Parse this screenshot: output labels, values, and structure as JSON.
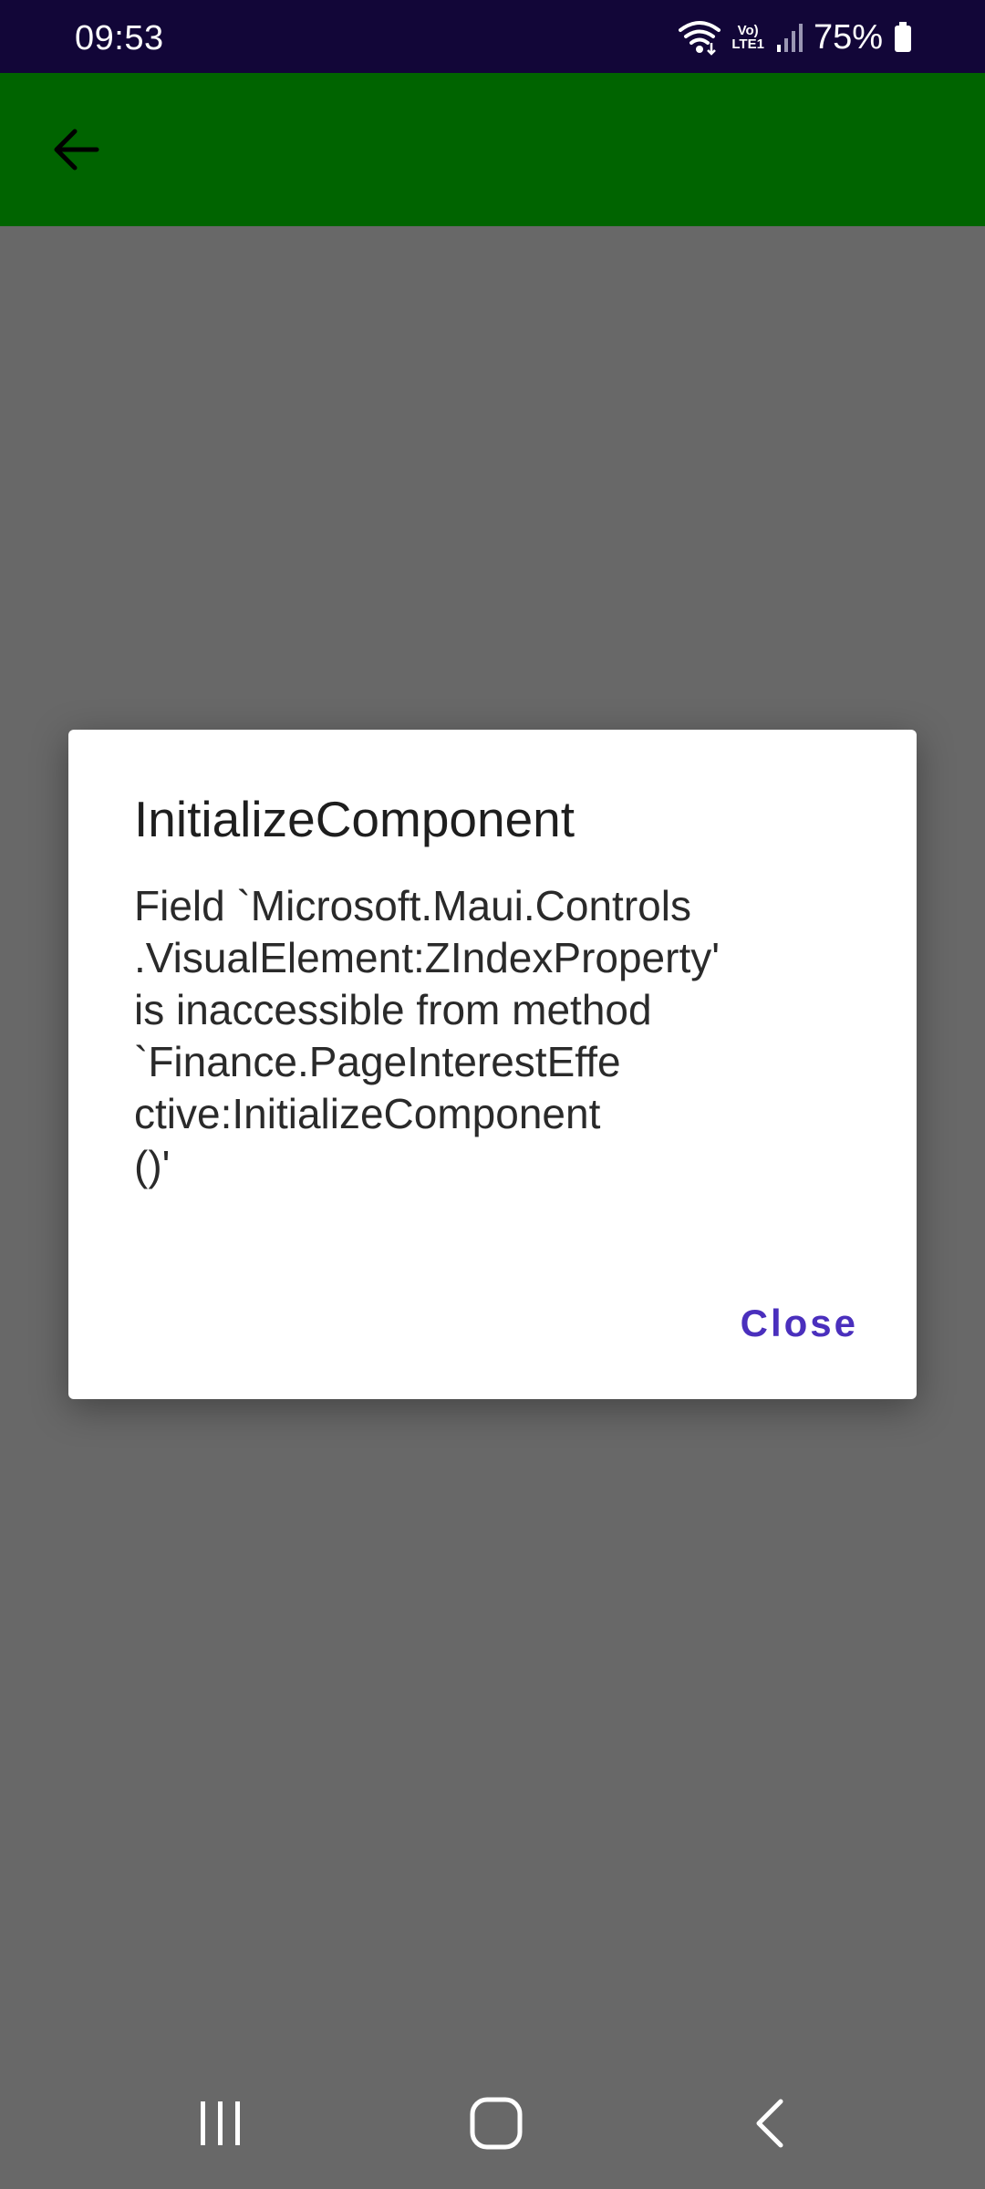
{
  "status_bar": {
    "time": "09:53",
    "network_label_top": "Vo)",
    "network_label_bottom": "LTE1",
    "battery_percent": "75%",
    "icons": [
      "wifi-icon",
      "signal-icon",
      "battery-icon"
    ]
  },
  "app_bar": {
    "color": "#006400",
    "back_icon": "arrow-left-icon"
  },
  "dialog": {
    "title": "InitializeComponent",
    "message": "Field `Microsoft.Maui.Controls\n.VisualElement:ZIndexProperty'\nis inaccessible from method\n`Finance.PageInterestEffe\nctive:InitializeComponent\n()'",
    "close_label": "Close",
    "accent_color": "#4a2fbd"
  },
  "nav_bar": {
    "icons": [
      "recent-apps-icon",
      "home-icon",
      "back-nav-icon"
    ]
  }
}
